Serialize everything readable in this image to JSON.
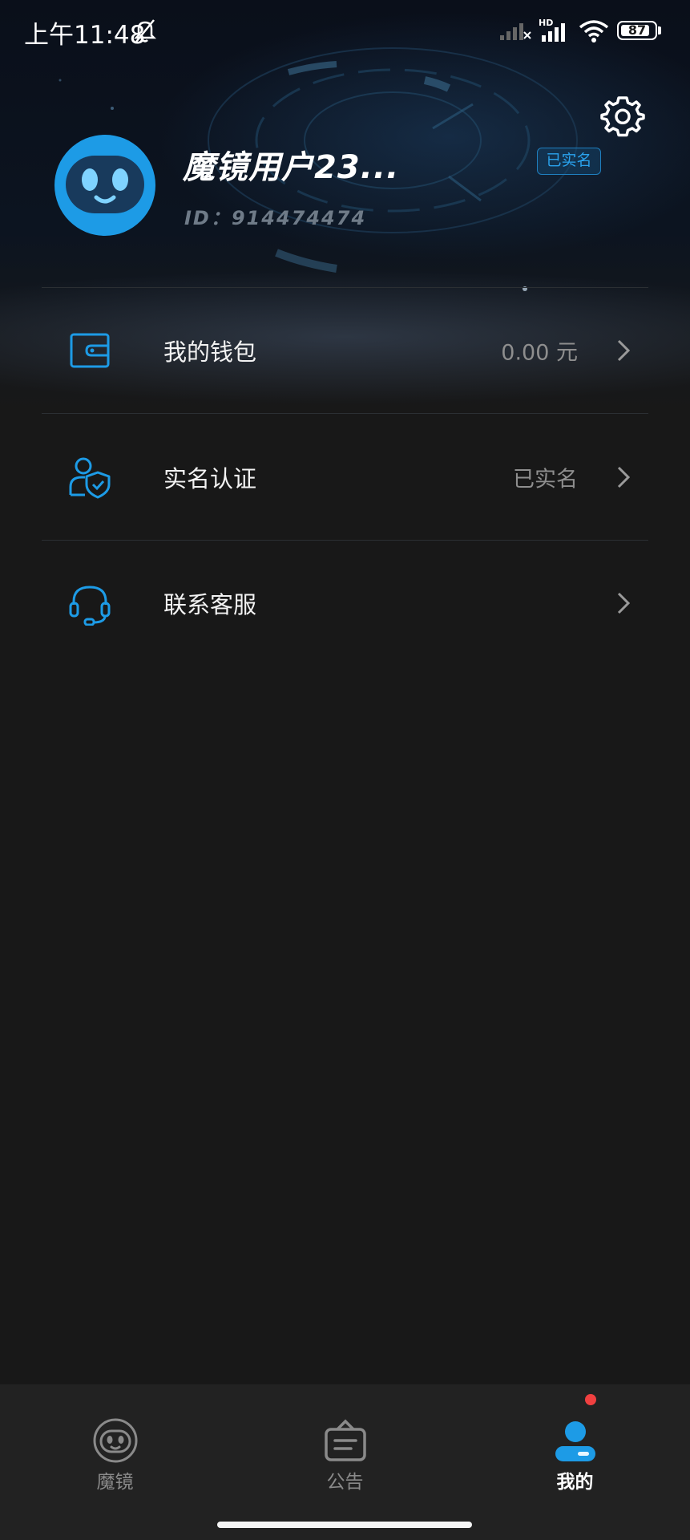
{
  "status_bar": {
    "time": "上午11:48",
    "network_badge": "HD",
    "battery_level": "87",
    "battery_percent": 87
  },
  "profile": {
    "username": "魔镜用户23...",
    "user_id": "ID：914474474",
    "verified_badge": "已实名"
  },
  "menu": {
    "items": [
      {
        "label": "我的钱包",
        "value": "0.00 元",
        "icon": "wallet-icon"
      },
      {
        "label": "实名认证",
        "value": "已实名",
        "icon": "identity-verified-icon"
      },
      {
        "label": "联系客服",
        "value": "",
        "icon": "headset-icon"
      }
    ]
  },
  "bottom_nav": {
    "items": [
      {
        "label": "魔镜",
        "icon": "mojing-robot-icon",
        "active": false
      },
      {
        "label": "公告",
        "icon": "announcement-icon",
        "active": false
      },
      {
        "label": "我的",
        "icon": "profile-icon",
        "active": true
      }
    ]
  },
  "colors": {
    "background": "#181818",
    "accent": "#1d9be6",
    "nav_background": "#222222",
    "notification_dot": "#f04040"
  }
}
